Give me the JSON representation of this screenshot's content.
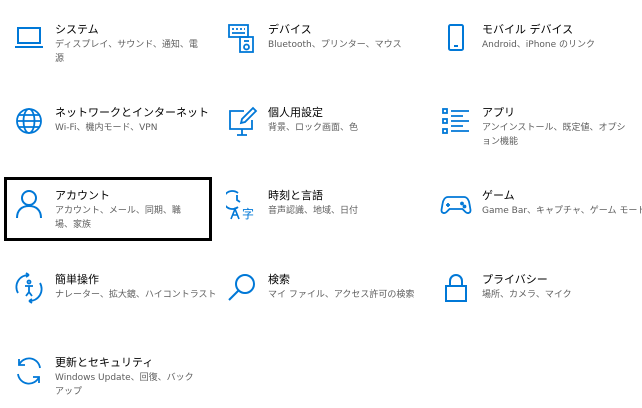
{
  "colors": {
    "accent": "#0078d7",
    "focus_border": "#000000",
    "description_text": "#5d5d5d"
  },
  "tiles": [
    {
      "id": "system",
      "icon": "laptop-icon",
      "title": "システム",
      "desc": "ディスプレイ、サウンド、通知、電源"
    },
    {
      "id": "devices",
      "icon": "keyboard-devices-icon",
      "title": "デバイス",
      "desc": "Bluetooth、プリンター、マウス"
    },
    {
      "id": "phone",
      "icon": "phone-icon",
      "title": "モバイル デバイス",
      "desc": "Android、iPhone のリンク"
    },
    {
      "id": "network",
      "icon": "globe-icon",
      "title": "ネットワークとインターネット",
      "desc": "Wi-Fi、機内モード、VPN"
    },
    {
      "id": "personalization",
      "icon": "personalization-icon",
      "title": "個人用設定",
      "desc": "背景、ロック画面、色"
    },
    {
      "id": "apps",
      "icon": "apps-list-icon",
      "title": "アプリ",
      "desc": "アンインストール、既定値、オプション機能"
    },
    {
      "id": "accounts",
      "icon": "person-icon",
      "title": "アカウント",
      "desc": "アカウント、メール、同期、職場、家族"
    },
    {
      "id": "time-language",
      "icon": "time-language-icon",
      "title": "時刻と言語",
      "desc": "音声認識、地域、日付"
    },
    {
      "id": "gaming",
      "icon": "gamepad-icon",
      "title": "ゲーム",
      "desc": "Game Bar、キャプチャ、ゲーム モード"
    },
    {
      "id": "ease-of-access",
      "icon": "ease-of-access-icon",
      "title": "簡単操作",
      "desc": "ナレーター、拡大鏡、ハイコントラスト"
    },
    {
      "id": "search",
      "icon": "search-icon",
      "title": "検索",
      "desc": "マイ ファイル、アクセス許可の検索"
    },
    {
      "id": "privacy",
      "icon": "lock-icon",
      "title": "プライバシー",
      "desc": "場所、カメラ、マイク"
    },
    {
      "id": "update-security",
      "icon": "update-icon",
      "title": "更新とセキュリティ",
      "desc": "Windows Update、回復、バックアップ"
    }
  ]
}
